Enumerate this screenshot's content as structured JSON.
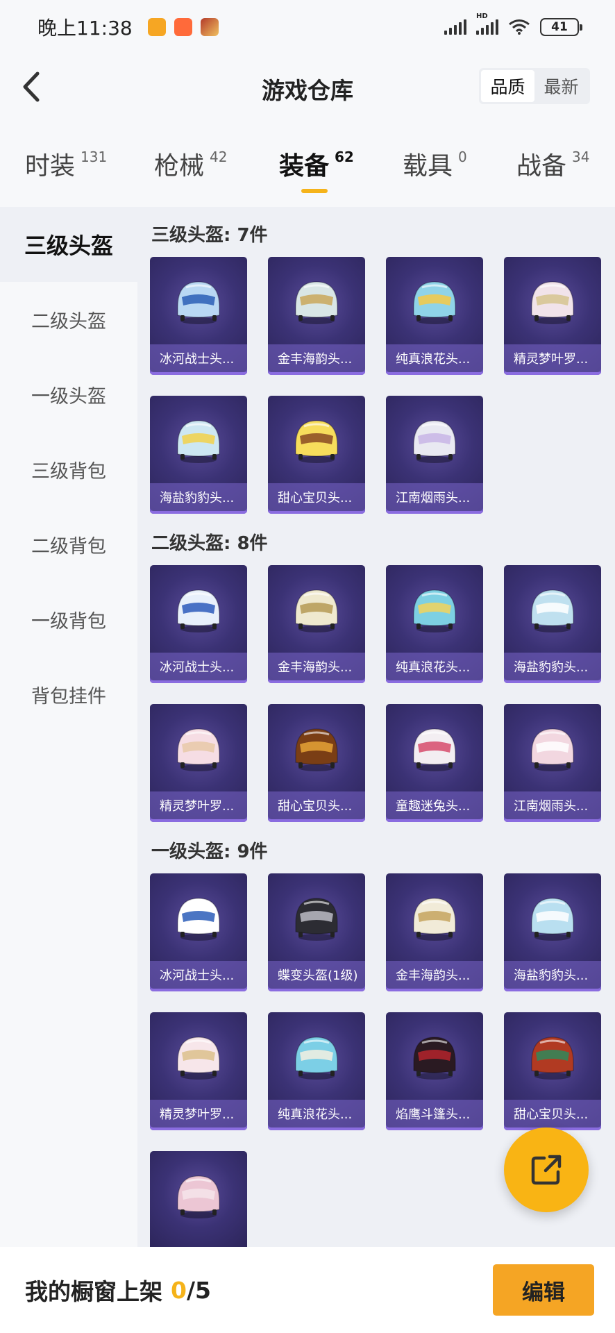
{
  "status_bar": {
    "time": "晚上11:38",
    "battery": "41",
    "signal_label": "HD"
  },
  "header": {
    "title": "游戏仓库",
    "sort_options": [
      "品质",
      "最新"
    ],
    "sort_active": "品质"
  },
  "tabs": [
    {
      "label": "时装",
      "count": "131"
    },
    {
      "label": "枪械",
      "count": "42"
    },
    {
      "label": "装备",
      "count": "62",
      "active": true
    },
    {
      "label": "载具",
      "count": "0"
    },
    {
      "label": "战备",
      "count": "34"
    }
  ],
  "sidebar": {
    "items": [
      "三级头盔",
      "二级头盔",
      "一级头盔",
      "三级背包",
      "二级背包",
      "一级背包",
      "背包挂件"
    ],
    "active": "三级头盔"
  },
  "sections": [
    {
      "title": "三级头盔: 7件",
      "items": [
        {
          "name": "冰河战士头...",
          "color": "#b9d8f3",
          "accent": "#2a5fb5"
        },
        {
          "name": "金丰海韵头...",
          "color": "#d9e6e6",
          "accent": "#c9a75a"
        },
        {
          "name": "纯真浪花头...",
          "color": "#8fd3e8",
          "accent": "#f6c945"
        },
        {
          "name": "精灵梦叶罗...",
          "color": "#f1e3ea",
          "accent": "#d6c48f"
        },
        {
          "name": "海盐豹豹头...",
          "color": "#cde7f2",
          "accent": "#f2d14a"
        },
        {
          "name": "甜心宝贝头...",
          "color": "#f7dd5c",
          "accent": "#8a4a22"
        },
        {
          "name": "江南烟雨头...",
          "color": "#e9e9f2",
          "accent": "#c8b5e6"
        }
      ]
    },
    {
      "title": "二级头盔: 8件",
      "items": [
        {
          "name": "冰河战士头...",
          "color": "#e8f0fb",
          "accent": "#2c5bbb"
        },
        {
          "name": "金丰海韵头...",
          "color": "#efe9cf",
          "accent": "#b59a55"
        },
        {
          "name": "纯真浪花头...",
          "color": "#7dd0e3",
          "accent": "#f2d35c"
        },
        {
          "name": "海盐豹豹头...",
          "color": "#bfe0ef",
          "accent": "#ffffff"
        },
        {
          "name": "精灵梦叶罗...",
          "color": "#f6dde4",
          "accent": "#e8c9a8"
        },
        {
          "name": "甜心宝贝头...",
          "color": "#7a3e15",
          "accent": "#e6a336"
        },
        {
          "name": "童趣迷兔头...",
          "color": "#f3eef2",
          "accent": "#d64b6c"
        },
        {
          "name": "江南烟雨头...",
          "color": "#f2d7e0",
          "accent": "#ffffff"
        }
      ]
    },
    {
      "title": "一级头盔: 9件",
      "items": [
        {
          "name": "冰河战士头...",
          "color": "#ffffff",
          "accent": "#2b5db8"
        },
        {
          "name": "蝶变头盔(1级)",
          "color": "#2c2c33",
          "accent": "#bcbcc6"
        },
        {
          "name": "金丰海韵头...",
          "color": "#f1ebd8",
          "accent": "#c5a45f"
        },
        {
          "name": "海盐豹豹头...",
          "color": "#b9dff0",
          "accent": "#ffffff"
        },
        {
          "name": "精灵梦叶罗...",
          "color": "#f7e6ea",
          "accent": "#dcc08c"
        },
        {
          "name": "纯真浪花头...",
          "color": "#7ccfe6",
          "accent": "#f4f0e0"
        },
        {
          "name": "焰鹰斗篷头...",
          "color": "#2a1a22",
          "accent": "#b4242b"
        },
        {
          "name": "甜心宝贝头...",
          "color": "#b13a22",
          "accent": "#2f8a5a"
        },
        {
          "name": "",
          "color": "#ecc6d4",
          "accent": "#f6e4ea"
        }
      ]
    }
  ],
  "bottom": {
    "label": "我的橱窗上架",
    "current": "0",
    "total": "/5",
    "edit_label": "编辑"
  }
}
